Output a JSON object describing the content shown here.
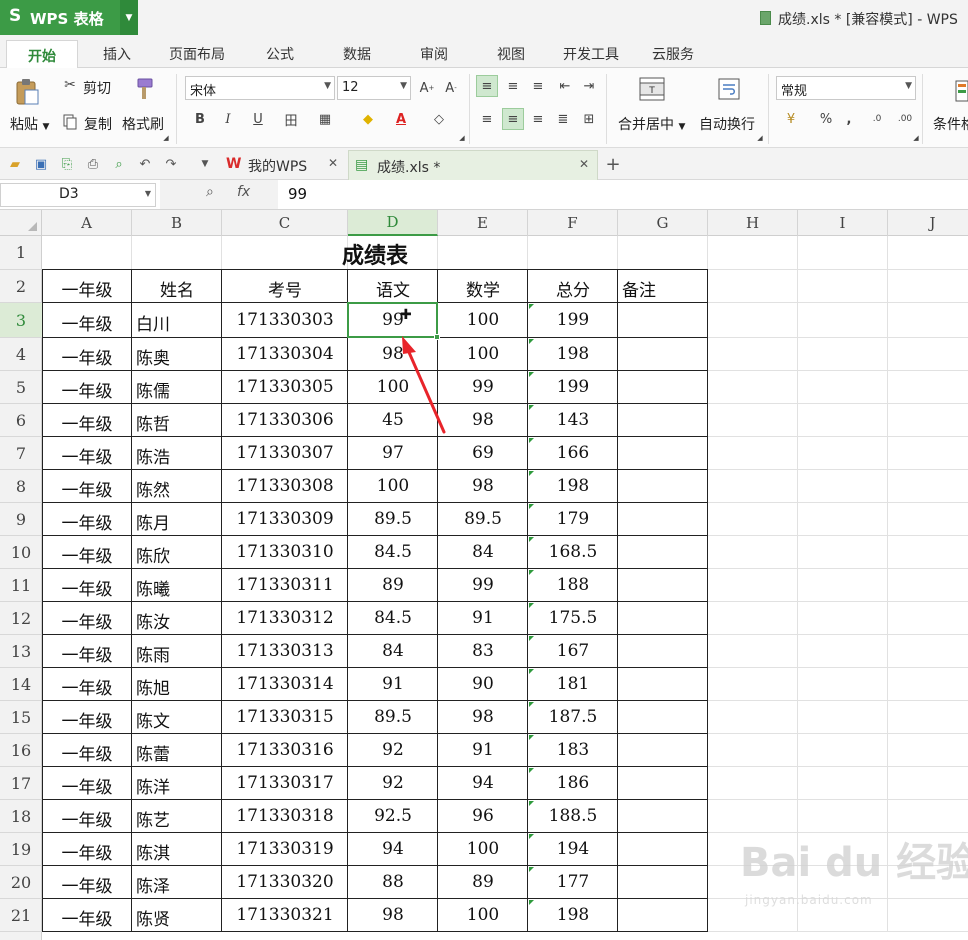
{
  "app": {
    "name": "WPS 表格",
    "logo_mark": "S",
    "window_title": "成绩.xls * [兼容模式] - WPS"
  },
  "ribbon_tabs": [
    "开始",
    "插入",
    "页面布局",
    "公式",
    "数据",
    "审阅",
    "视图",
    "开发工具",
    "云服务"
  ],
  "ribbon": {
    "paste": "粘贴",
    "cut": "剪切",
    "copy": "复制",
    "format_painter": "格式刷",
    "font_name": "宋体",
    "font_size": "12",
    "merge_center": "合并居中",
    "wrap_text": "自动换行",
    "number_format": "常规",
    "percent": "%",
    "comma": ",",
    "cond_format": "条件格"
  },
  "doc_tabs": [
    {
      "label": "我的WPS"
    },
    {
      "label": "成绩.xls *"
    }
  ],
  "formula_bar": {
    "name_box": "D3",
    "fx": "fx",
    "value": "99"
  },
  "column_headers": [
    "A",
    "B",
    "C",
    "D",
    "E",
    "F",
    "G",
    "H",
    "I",
    "J"
  ],
  "row_headers": [
    "1",
    "2",
    "3",
    "4",
    "5",
    "6",
    "7",
    "8",
    "9",
    "10",
    "11",
    "12",
    "13",
    "14",
    "15",
    "16",
    "17",
    "18",
    "19",
    "20",
    "21"
  ],
  "sheet": {
    "title": "成绩表",
    "headers": [
      "一年级",
      "姓名",
      "考号",
      "语文",
      "数学",
      "总分",
      "备注"
    ],
    "rows": [
      [
        "一年级",
        "白川",
        "171330303",
        "99",
        "100",
        "199"
      ],
      [
        "一年级",
        "陈奥",
        "171330304",
        "98",
        "100",
        "198"
      ],
      [
        "一年级",
        "陈儒",
        "171330305",
        "100",
        "99",
        "199"
      ],
      [
        "一年级",
        "陈哲",
        "171330306",
        "45",
        "98",
        "143"
      ],
      [
        "一年级",
        "陈浩",
        "171330307",
        "97",
        "69",
        "166"
      ],
      [
        "一年级",
        "陈然",
        "171330308",
        "100",
        "98",
        "198"
      ],
      [
        "一年级",
        "陈月",
        "171330309",
        "89.5",
        "89.5",
        "179"
      ],
      [
        "一年级",
        "陈欣",
        "171330310",
        "84.5",
        "84",
        "168.5"
      ],
      [
        "一年级",
        "陈曦",
        "171330311",
        "89",
        "99",
        "188"
      ],
      [
        "一年级",
        "陈汝",
        "171330312",
        "84.5",
        "91",
        "175.5"
      ],
      [
        "一年级",
        "陈雨",
        "171330313",
        "84",
        "83",
        "167"
      ],
      [
        "一年级",
        "陈旭",
        "171330314",
        "91",
        "90",
        "181"
      ],
      [
        "一年级",
        "陈文",
        "171330315",
        "89.5",
        "98",
        "187.5"
      ],
      [
        "一年级",
        "陈蕾",
        "171330316",
        "92",
        "91",
        "183"
      ],
      [
        "一年级",
        "陈洋",
        "171330317",
        "92",
        "94",
        "186"
      ],
      [
        "一年级",
        "陈艺",
        "171330318",
        "92.5",
        "96",
        "188.5"
      ],
      [
        "一年级",
        "陈淇",
        "171330319",
        "94",
        "100",
        "194"
      ],
      [
        "一年级",
        "陈泽",
        "171330320",
        "88",
        "89",
        "177"
      ],
      [
        "一年级",
        "陈贤",
        "171330321",
        "98",
        "100",
        "198"
      ]
    ]
  },
  "selected_cell": "D3",
  "watermark": {
    "main": "Bai du 经验",
    "sub": "jingyan.baidu.com"
  },
  "colors": {
    "brand": "#3c9b46",
    "annotation_arrow": "#e8242a"
  }
}
